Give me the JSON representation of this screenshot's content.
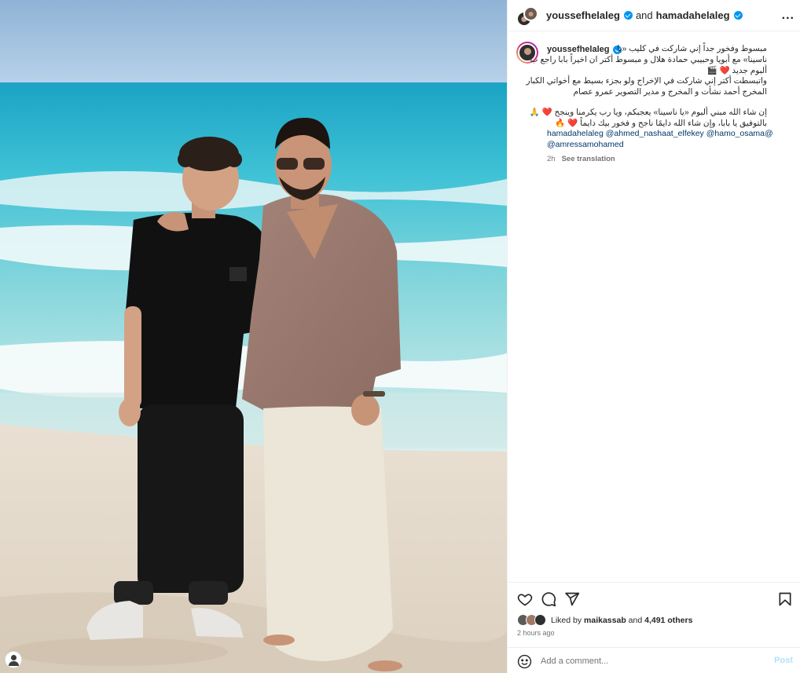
{
  "header": {
    "author": "youssefhelaleg",
    "conjunction": "and",
    "collaborator": "hamadahelaleg",
    "more_label": "..."
  },
  "caption": {
    "username": "youssefhelaleg",
    "lines": [
      "مبسوط وفخور جداً إني شاركت في كليب «يا",
      "ناسينا» مع أبويا وحبيبي حمادة هلال و مبسوط أكتر ان اخيراً بابا راجع ب",
      "ألبوم جديد ❤️ 🎬",
      "واتبسطت أكتر إني شاركت في الإخراج ولو بجزء بسيط مع أخواتي الكبار",
      "المخرج أحمد نشأت و المخرج و مدير التصوير عمرو عصام",
      "إن شاء الله مبني ألبوم «يا ناسينا» يعجبكم، ويا رب يكرمنا وينجح ❤️ 🙏",
      "بالتوفيق يا بابا، وإن شاء الله دايمًا ناجح و فخور بيك دايماً ❤️ 🔥"
    ],
    "mentions": [
      "hamadahelaleg",
      "@ahmed_nashaat_elfekey",
      "@hamo_osama@",
      "@amressamohamed"
    ],
    "time": "2h",
    "see_translation": "See translation"
  },
  "icons": {
    "like": "heart-icon",
    "comment": "comment-icon",
    "share": "send-icon",
    "save": "bookmark-icon",
    "emoji": "emoji-icon",
    "verified": "verified-badge-icon"
  },
  "likes": {
    "prefix": "Liked by",
    "user": "maikassab",
    "connector": "and",
    "others": "4,491 others"
  },
  "posted_ago": "2 hours ago",
  "comment": {
    "placeholder": "Add a comment...",
    "post_label": "Post"
  },
  "colors": {
    "verified": "#0095f6",
    "link": "#00376b",
    "post_disabled": "#b2dffc",
    "muted": "#737373"
  }
}
